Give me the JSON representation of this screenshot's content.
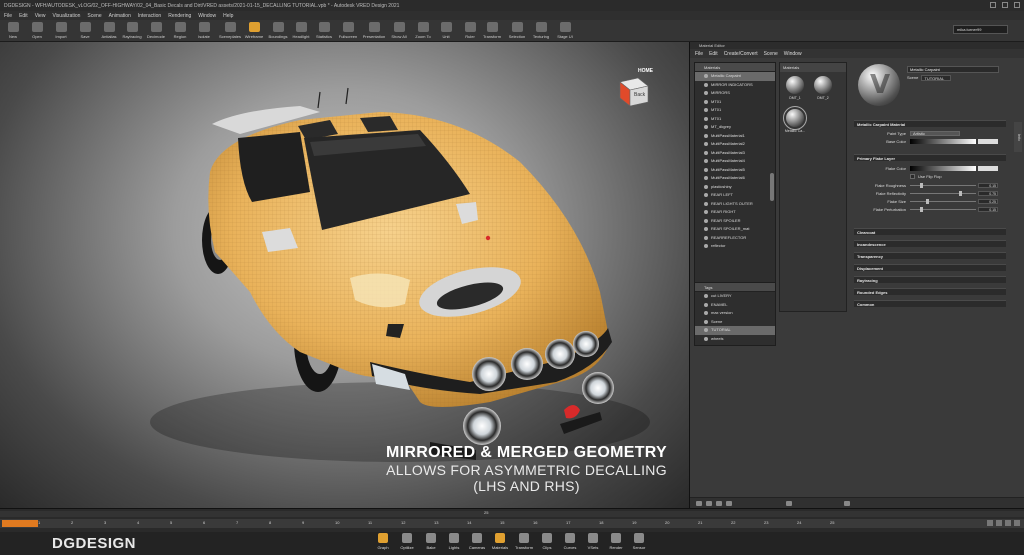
{
  "window": {
    "title": "DGDESIGN - WFH/AUTODESK_vLOG/02_OFF-HIGHWAY/02_04_Basic Decals and Dirt/VRED assets/2021-01-15_DECALLING TUTORIAL.vpb * - Autodesk VRED Design 2021"
  },
  "menu": [
    "File",
    "Edit",
    "View",
    "Visualization",
    "Scene",
    "Animation",
    "Interaction",
    "Rendering",
    "Window",
    "Help"
  ],
  "toolbar": {
    "items": [
      "New",
      "Open",
      "Import",
      "Save",
      "Antialias",
      "Raytracing",
      "Decimode",
      "Region",
      "Isolate",
      "Sceneplates",
      "Wireframe",
      "Boundings",
      "Headlight",
      "Statistics",
      "Fullscreen",
      "Presentation",
      "Show All",
      "Zoom To",
      "Unit",
      "Ruler",
      "Transform",
      "Selection",
      "Texturing",
      "Stage UI"
    ],
    "user": "mika.turner99"
  },
  "viewport": {
    "navcube_labels": [
      "HOME",
      "Back"
    ],
    "overlay": {
      "line1": "MIRRORED & MERGED GEOMETRY",
      "line2": "ALLOWS FOR ASYMMETRIC DECALLING",
      "line3": "(LHS AND RHS)"
    }
  },
  "material_editor": {
    "title": "Material Editor",
    "menu": [
      "File",
      "Edit",
      "Create/Convert",
      "Scene",
      "Window"
    ],
    "tree_header": "Materials",
    "materials": [
      "Metallic Carpaint",
      "MIRROR INDICATORS",
      "MIRRORS",
      "MT01",
      "MT01",
      "MT01",
      "MT_dkgrey",
      "MultiPassMaterial1",
      "MultiPassMaterial2",
      "MultiPassMaterial3",
      "MultiPassMaterial4",
      "MultiPassMaterial5",
      "MultiPassMaterial6",
      "plasticshiny",
      "REAR LEFT",
      "REAR LIGHTS OUTER",
      "REAR RIGHT",
      "REAR SPOILER",
      "REAR SPOILER_mat",
      "REARREFLECTOR",
      "reflector"
    ],
    "selected_material": "Metallic Carpaint",
    "tags_header": "Tags",
    "tags": [
      "cut LIVERY",
      "ENAMEL",
      "max version",
      "Scene",
      "TUTORIAL",
      "wheels"
    ],
    "selected_tag": "TUTORIAL",
    "thumbs_header": "Materials",
    "thumbs": [
      "DMT_1",
      "DMT_2",
      "Metallic Ca..."
    ],
    "props": {
      "name": "Metallic Carpaint",
      "scene_label": "Scene",
      "scene_value": "TUTORIAL",
      "sections": {
        "main": "Metallic Carpaint Material",
        "flakes": "Primary Flake Layer",
        "collapsed": [
          "Clearcoat",
          "Incandescence",
          "Transparency",
          "Displacement",
          "Raytracing",
          "Rounded Edges",
          "Common"
        ]
      },
      "paint_type_label": "Paint Type",
      "paint_type_value": "Artistic",
      "base_color_label": "Base Color",
      "flake_color_label": "Flake Color",
      "use_flip_flop_label": "Use Flip Flop",
      "flake_roughness_label": "Flake Roughness",
      "flake_roughness_value": "0.15",
      "flake_reflectivity_label": "Flake Reflectivity",
      "flake_reflectivity_value": "0.75",
      "flake_size_label": "Flake Size",
      "flake_size_value": "0.25",
      "flake_perturbation_label": "Flake Perturbation",
      "flake_perturbation_value": "0.15"
    },
    "side_tab": "Info"
  },
  "timeline": {
    "marker": "25",
    "ticks": [
      "1",
      "2",
      "3",
      "4",
      "5",
      "6",
      "7",
      "8",
      "9",
      "10",
      "11",
      "12",
      "13",
      "14",
      "15",
      "16",
      "17",
      "18",
      "19",
      "20",
      "21",
      "22",
      "23",
      "24",
      "25"
    ]
  },
  "bottom": {
    "brand": "DGDESIGN",
    "modules": [
      "Graph",
      "Optilize",
      "Bake",
      "Lights",
      "Cameras",
      "Materials",
      "Transform",
      "Clips",
      "Curves",
      "VSets",
      "Render",
      "Sensor"
    ]
  },
  "colors": {
    "accent": "#e0a030",
    "timeline_play": "#e07a20",
    "car_body": "#e9b25a"
  }
}
